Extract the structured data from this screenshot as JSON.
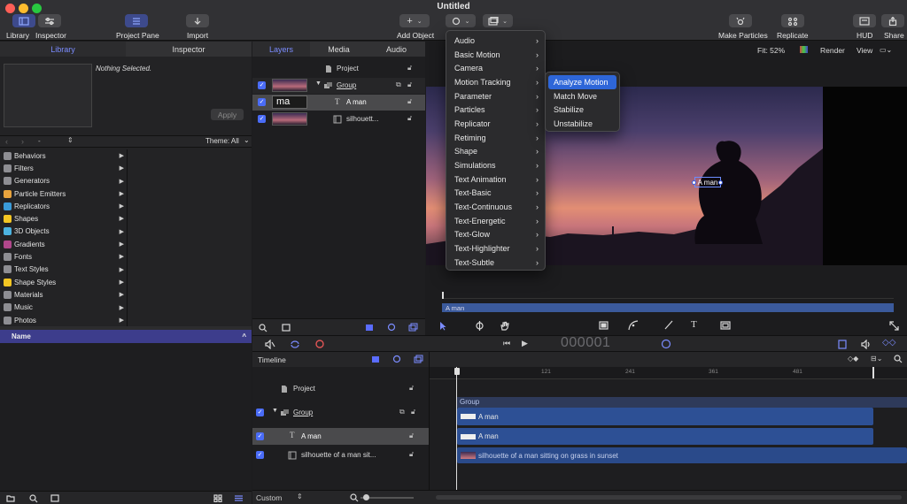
{
  "window": {
    "title": "Untitled"
  },
  "toolbar": {
    "library": "Library",
    "inspector": "Inspector",
    "project_pane": "Project Pane",
    "import": "Import",
    "add_object": "Add Object",
    "make_particles": "Make Particles",
    "replicate": "Replicate",
    "hud": "HUD",
    "share": "Share"
  },
  "library_panel": {
    "tab_library": "Library",
    "tab_inspector": "Inspector",
    "nothing_selected": "Nothing Selected.",
    "apply": "Apply",
    "theme": "Theme: All",
    "path": "-",
    "name_header": "Name",
    "categories": [
      {
        "label": "Behaviors",
        "color": "#8e8e93",
        "icon": "gear-icon"
      },
      {
        "label": "Filters",
        "color": "#8e8e93",
        "icon": "filter-icon"
      },
      {
        "label": "Generators",
        "color": "#8e8e93",
        "icon": "generator-icon"
      },
      {
        "label": "Particle Emitters",
        "color": "#e8a33d",
        "icon": "particle-icon"
      },
      {
        "label": "Replicators",
        "color": "#3a9bd9",
        "icon": "replicator-icon"
      },
      {
        "label": "Shapes",
        "color": "#f3c623",
        "icon": "shape-icon"
      },
      {
        "label": "3D Objects",
        "color": "#4cb3e0",
        "icon": "cube-icon"
      },
      {
        "label": "Gradients",
        "color": "#b0478b",
        "icon": "gradient-icon"
      },
      {
        "label": "Fonts",
        "color": "#8e8e93",
        "icon": "font-icon"
      },
      {
        "label": "Text Styles",
        "color": "#8e8e93",
        "icon": "text-style-icon"
      },
      {
        "label": "Shape Styles",
        "color": "#f3c623",
        "icon": "shape-style-icon"
      },
      {
        "label": "Materials",
        "color": "#8e8e93",
        "icon": "material-icon"
      },
      {
        "label": "Music",
        "color": "#8e8e93",
        "icon": "music-icon"
      },
      {
        "label": "Photos",
        "color": "#8e8e93",
        "icon": "photo-icon"
      }
    ]
  },
  "layers_panel": {
    "tab_layers": "Layers",
    "tab_media": "Media",
    "tab_audio": "Audio",
    "project": "Project",
    "group": "Group",
    "text_layer": "A man",
    "text_thumb": "ma",
    "photo_layer": "silhouett..."
  },
  "canvas": {
    "fit": "Fit: 52%",
    "render": "Render",
    "view": "View",
    "timebar_label": "A man",
    "selection_text": "A man"
  },
  "add_object_menu": {
    "items": [
      "Audio",
      "Basic Motion",
      "Camera",
      "Motion Tracking",
      "Parameter",
      "Particles",
      "Replicator",
      "Retiming",
      "Shape",
      "Simulations",
      "Text Animation",
      "Text-Basic",
      "Text-Continuous",
      "Text-Energetic",
      "Text-Glow",
      "Text-Highlighter",
      "Text-Subtle"
    ],
    "highlighted": "Motion Tracking"
  },
  "motion_tracking_submenu": {
    "items": [
      "Analyze Motion",
      "Match Move",
      "Stabilize",
      "Unstabilize"
    ],
    "highlighted": "Analyze Motion"
  },
  "transport": {
    "timecode": "000001"
  },
  "timeline": {
    "label": "Timeline",
    "project": "Project",
    "group": "Group",
    "text_layer": "A man",
    "photo_layer": "silhouette of a man sit...",
    "ruler": [
      "1",
      "121",
      "241",
      "361",
      "481"
    ],
    "bar_group": "Group",
    "bar_text1": "A man",
    "bar_text2": "A man",
    "bar_photo": "silhouette of a man sitting on grass in sunset"
  },
  "bottom": {
    "custom": "Custom"
  }
}
